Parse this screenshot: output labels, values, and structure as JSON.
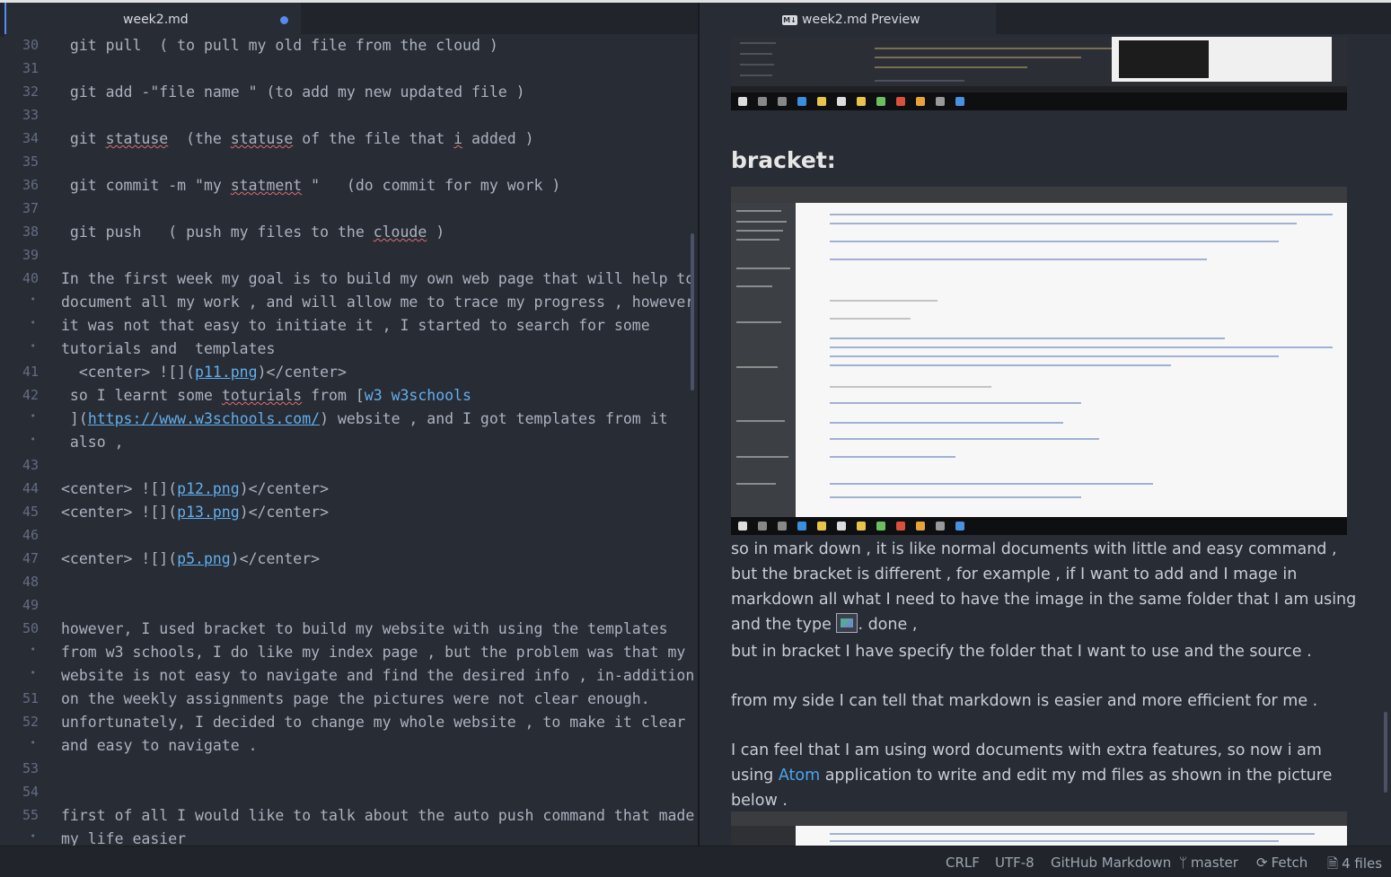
{
  "tabs": {
    "editor": {
      "title": "week2.md",
      "modified": true
    },
    "preview": {
      "title": "week2.md Preview",
      "icon": "markdown-icon",
      "icon_text": "M↓"
    }
  },
  "editor": {
    "lines": [
      {
        "no": "30",
        "text": " git pull  ( to pull my old file from the cloud )"
      },
      {
        "no": "31",
        "text": ""
      },
      {
        "no": "32",
        "text": " git add -\"file name \" (to add my new updated file )"
      },
      {
        "no": "33",
        "text": ""
      },
      {
        "no": "34",
        "text": " git statuse  (the statuse of the file that i added )"
      },
      {
        "no": "35",
        "text": ""
      },
      {
        "no": "36",
        "text": " git commit -m \"my statment \"   (do commit for my work )"
      },
      {
        "no": "37",
        "text": ""
      },
      {
        "no": "38",
        "text": " git push   ( push my files to the cloude )"
      },
      {
        "no": "39",
        "text": ""
      },
      {
        "no": "40",
        "text": "In the first week my goal is to build my own web page that will help to"
      },
      {
        "no": "•",
        "text": "document all my work , and will allow me to trace my progress , however"
      },
      {
        "no": "•",
        "text": "it was not that easy to initiate it , I started to search for some"
      },
      {
        "no": "•",
        "text": "tutorials and  templates"
      },
      {
        "no": "41",
        "text": "  <center> ![](p11.png)</center>"
      },
      {
        "no": "42",
        "text": " so I learnt some toturials from [w3 w3schools"
      },
      {
        "no": "•",
        "text": " ](https://www.w3schools.com/) website , and I got templates from it"
      },
      {
        "no": "•",
        "text": " also ,"
      },
      {
        "no": "43",
        "text": ""
      },
      {
        "no": "44",
        "text": "<center> ![](p12.png)</center>"
      },
      {
        "no": "45",
        "text": "<center> ![](p13.png)</center>"
      },
      {
        "no": "46",
        "text": ""
      },
      {
        "no": "47",
        "text": "<center> ![](p5.png)</center>"
      },
      {
        "no": "48",
        "text": ""
      },
      {
        "no": "49",
        "text": ""
      },
      {
        "no": "50",
        "text": "however, I used bracket to build my website with using the templates"
      },
      {
        "no": "•",
        "text": "from w3 schools, I do like my index page , but the problem was that my"
      },
      {
        "no": "•",
        "text": "website is not easy to navigate and find the desired info , in-addition"
      },
      {
        "no": "51",
        "text": "on the weekly assignments page the pictures were not clear enough."
      },
      {
        "no": "52",
        "text": "unfortunately, I decided to change my whole website , to make it clear"
      },
      {
        "no": "•",
        "text": "and easy to navigate ."
      },
      {
        "no": "53",
        "text": ""
      },
      {
        "no": "54",
        "text": ""
      },
      {
        "no": "55",
        "text": "first of all I would like to talk about the auto push command that made"
      },
      {
        "no": "•",
        "text": "my life easier"
      }
    ]
  },
  "preview": {
    "heading": "bracket:",
    "para1": "so in mark down , it is like normal documents with little and easy command , but the bracket is different , for example , if I want to add and I mage in markdown all what I need to have the image in the same folder that I am using and the type",
    "para1_end": ". done ,",
    "para2": "but in bracket I have specify the folder that I want to use and the source .",
    "para3": "from my side I can tell that markdown is easier and more efficient for me .",
    "para4_a": "I can feel that I am using word documents with extra features, so now i am using ",
    "para4_link": "Atom",
    "para4_b": " application to write and edit my md files as shown in the picture below ."
  },
  "statusbar": {
    "line_ending": "CRLF",
    "encoding": "UTF-8",
    "grammar": "GitHub Markdown",
    "branch": "master",
    "fetch": "Fetch",
    "files": "4 files"
  }
}
